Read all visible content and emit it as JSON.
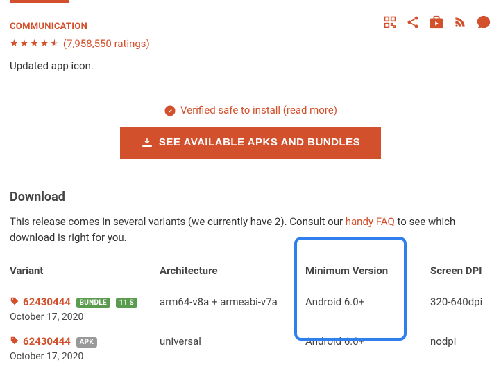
{
  "header": {
    "category": "COMMUNICATION",
    "ratings_count_text": "(7,958,550 ratings)",
    "update_note": "Updated app icon.",
    "verified_text": "Verified safe to install (read more)",
    "cta_label": "SEE AVAILABLE APKS AND BUNDLES"
  },
  "download": {
    "title": "Download",
    "desc_pre": "This release comes in several variants (we currently have 2). Consult our ",
    "faq_link_text": "handy FAQ",
    "desc_post": " to see which download is right for you.",
    "columns": {
      "variant": "Variant",
      "architecture": "Architecture",
      "min_version": "Minimum Version",
      "dpi": "Screen DPI"
    },
    "rows": [
      {
        "code": "62430444",
        "badges": [
          "BUNDLE",
          "11 S"
        ],
        "date": "October 17, 2020",
        "architecture": "arm64-v8a + armeabi-v7a",
        "min_version": "Android 6.0+",
        "dpi": "320-640dpi"
      },
      {
        "code": "62430444",
        "badges": [
          "APK"
        ],
        "date": "October 17, 2020",
        "architecture": "universal",
        "min_version": "Android 6.0+",
        "dpi": "nodpi"
      }
    ]
  },
  "highlight": {
    "column": "min_version"
  }
}
